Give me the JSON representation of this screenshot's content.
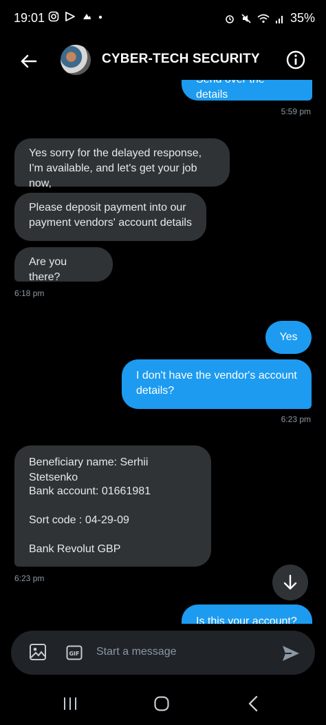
{
  "status_bar": {
    "time": "19:01",
    "battery": "35%"
  },
  "header": {
    "title": "CYBER-TECH SECURITY"
  },
  "messages": [
    {
      "side": "out",
      "text": "Send over the details"
    },
    {
      "side": "time-out",
      "text": "5:59 pm"
    },
    {
      "side": "in",
      "text": "Yes sorry for the delayed response, I'm available, and let's get your job now,"
    },
    {
      "side": "in",
      "text": "Please deposit payment into our payment vendors' account details"
    },
    {
      "side": "in",
      "text": "Are you there?"
    },
    {
      "side": "time-in",
      "text": "6:18 pm"
    },
    {
      "side": "out",
      "text": "Yes"
    },
    {
      "side": "out",
      "text": "I don't have the vendor's account details?"
    },
    {
      "side": "time-out",
      "text": "6:23 pm"
    },
    {
      "side": "in",
      "lines": [
        "Beneficiary name: Serhii Stetsenko",
        "Bank account: 01661981",
        "Sort code : 04-29-09",
        "Bank Revolut GBP"
      ]
    },
    {
      "side": "time-in",
      "text": "6:23 pm"
    },
    {
      "side": "out",
      "text": "Is this your account?"
    }
  ],
  "composer": {
    "placeholder": "Start a message"
  },
  "colors": {
    "background": "#000000",
    "incoming_bubble": "#2f3336",
    "outgoing_bubble": "#1d9bf0",
    "timestamp": "#8b98a5"
  }
}
